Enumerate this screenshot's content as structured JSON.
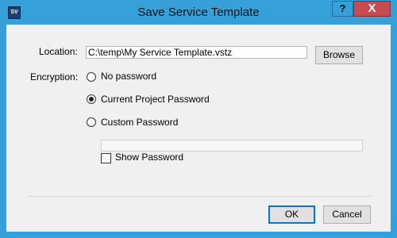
{
  "window": {
    "title": "Save Service Template",
    "app_icon_text": "SV",
    "help_label": "?",
    "close_label": "X"
  },
  "location": {
    "label": "Location:",
    "value": "C:\\temp\\My Service Template.vstz",
    "browse_label": "Browse"
  },
  "encryption": {
    "label": "Encryption:",
    "options": [
      {
        "label": "No password",
        "checked": false
      },
      {
        "label": "Current Project Password",
        "checked": true
      },
      {
        "label": "Custom Password",
        "checked": false
      }
    ],
    "password_value": "",
    "show_password_label": "Show Password",
    "show_password_checked": false
  },
  "footer": {
    "ok_label": "OK",
    "cancel_label": "Cancel"
  }
}
